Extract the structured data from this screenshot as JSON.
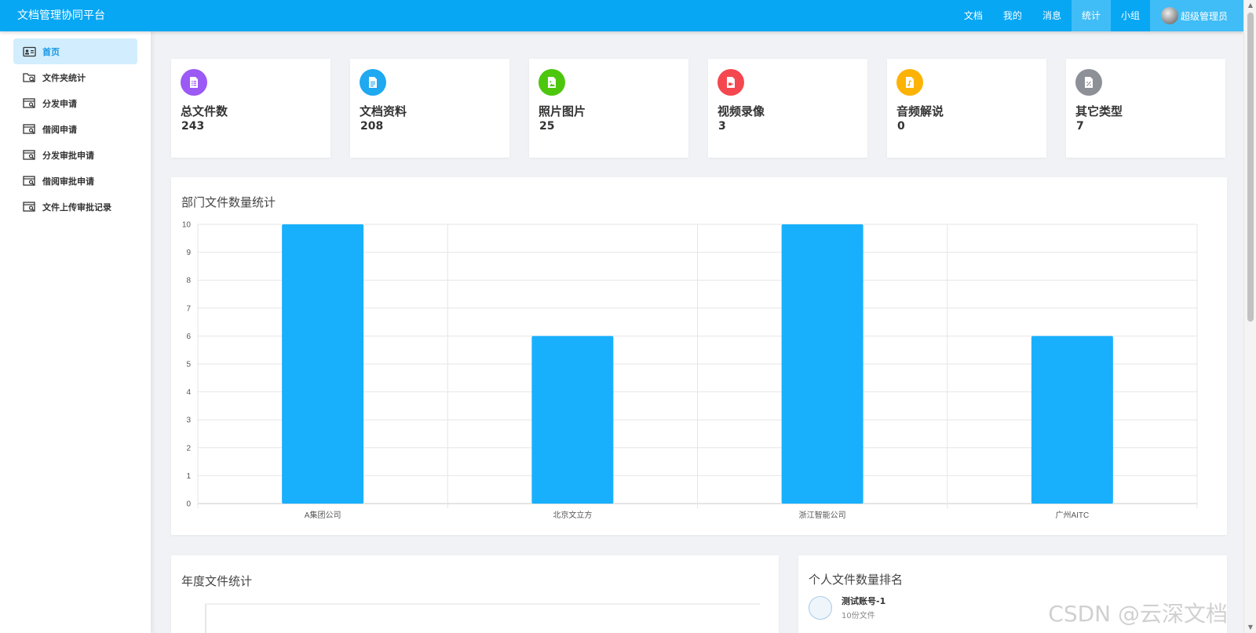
{
  "app": {
    "title": "文档管理协同平台"
  },
  "topnav": {
    "items": [
      "文档",
      "我的",
      "消息",
      "统计",
      "小组"
    ],
    "active_index": 3,
    "user_label": "超级管理员"
  },
  "sidebar": {
    "items": [
      {
        "label": "首页",
        "active": true
      },
      {
        "label": "文件夹统计"
      },
      {
        "label": "分发申请"
      },
      {
        "label": "借阅申请"
      },
      {
        "label": "分发审批申请"
      },
      {
        "label": "借阅审批申请"
      },
      {
        "label": "文件上传审批记录"
      }
    ]
  },
  "cards": [
    {
      "title": "总文件数",
      "value": "243",
      "color": "#9b59f5",
      "icon": "list-document-icon"
    },
    {
      "title": "文档资料",
      "value": "208",
      "color": "#1ea9f0",
      "icon": "text-document-icon"
    },
    {
      "title": "照片图片",
      "value": "25",
      "color": "#4cc70d",
      "icon": "image-document-icon"
    },
    {
      "title": "视频录像",
      "value": "3",
      "color": "#f5474f",
      "icon": "video-document-icon"
    },
    {
      "title": "音频解说",
      "value": "0",
      "color": "#fdb305",
      "icon": "audio-document-icon"
    },
    {
      "title": "其它类型",
      "value": "7",
      "color": "#8d9097",
      "icon": "other-document-icon"
    }
  ],
  "dept_panel": {
    "title": "部门文件数量统计"
  },
  "chart_data": {
    "type": "bar",
    "title": "部门文件数量统计",
    "categories": [
      "A集团公司",
      "北京文立方",
      "浙江智能公司",
      "广州AITC"
    ],
    "values": [
      10,
      6,
      10,
      6
    ],
    "ylim": [
      0,
      10
    ],
    "yticks": [
      "0",
      "1",
      "2",
      "3",
      "4",
      "5",
      "6",
      "7",
      "8",
      "9",
      "10"
    ],
    "xlabel": "",
    "ylabel": "",
    "grid": true,
    "bar_color": "#18b0fd"
  },
  "year_panel": {
    "title": "年度文件统计"
  },
  "rank_panel": {
    "title": "个人文件数量排名",
    "items": [
      {
        "name": "测试账号-1",
        "sub": "10份文件"
      }
    ]
  },
  "watermark": "CSDN @云深文档"
}
